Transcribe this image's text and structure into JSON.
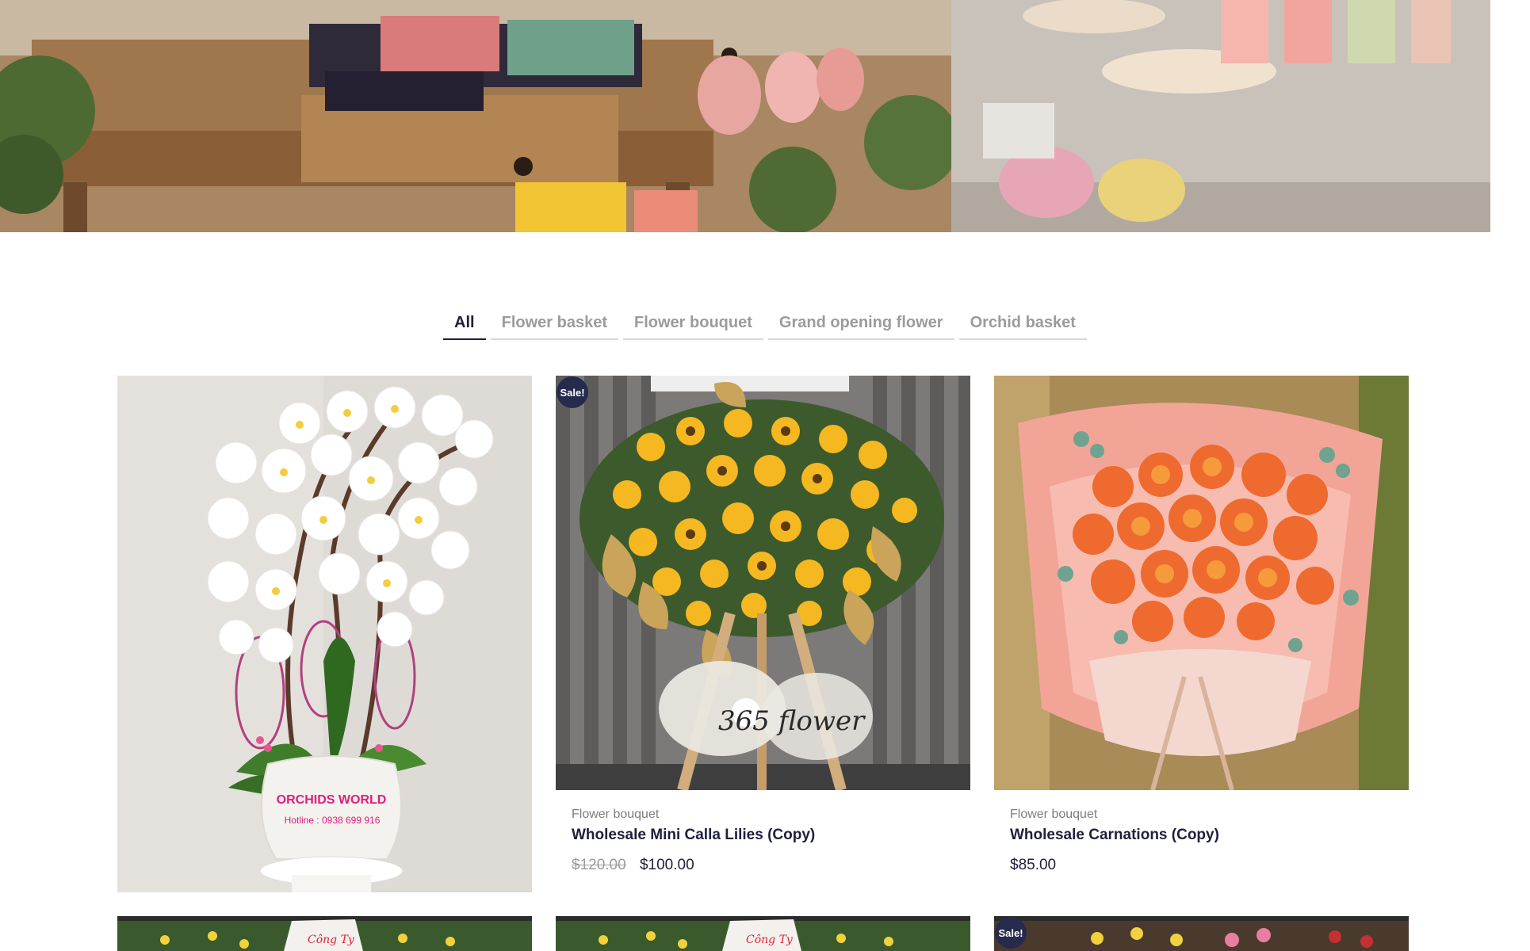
{
  "tabs": [
    {
      "label": "All",
      "active": true
    },
    {
      "label": "Flower basket",
      "active": false
    },
    {
      "label": "Flower bouquet",
      "active": false
    },
    {
      "label": "Grand opening flower",
      "active": false
    },
    {
      "label": "Orchid basket",
      "active": false
    }
  ],
  "products": [
    {
      "image": "white-orchid-pot",
      "image_text": [
        "ORCHIDS WORLD",
        "Hotline : 0938 699 916"
      ],
      "category": "",
      "title": "",
      "price": ""
    },
    {
      "image": "yellow-sunflower-stand",
      "sale": "Sale!",
      "image_text": [
        "365 flower"
      ],
      "category": "Flower bouquet",
      "title": "Wholesale Mini Calla Lilies (Copy)",
      "old_price": "$120.00",
      "price": "$100.00"
    },
    {
      "image": "orange-rose-bouquet",
      "category": "Flower bouquet",
      "title": "Wholesale Carnations (Copy)",
      "price": "$85.00"
    },
    {
      "image": "congratulation-stand"
    },
    {
      "image": "congratulation-stand"
    },
    {
      "image": "flower-stand",
      "sale": "Sale!"
    }
  ],
  "colors": {
    "accent": "#262a4d",
    "tab_inactive": "#9b9b9b",
    "tab_active": "#1f1f3d",
    "price_old": "#9b9b9b"
  }
}
